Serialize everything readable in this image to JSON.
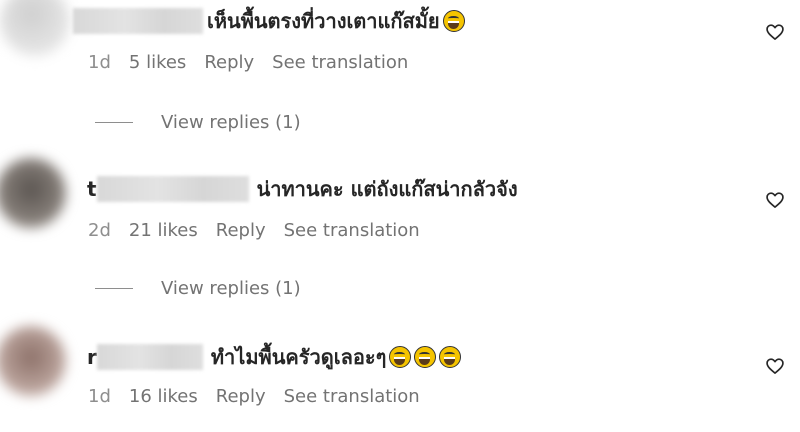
{
  "comments": [
    {
      "username_initial": "",
      "text": "เห็นพื้นตรงที่วางเตาแก๊สมั้ย",
      "emoji_count": 1,
      "time": "1d",
      "likes": "5 likes",
      "reply": "Reply",
      "translation": "See translation",
      "view_replies": "View replies (1)",
      "like_icon": "heart-outline-icon"
    },
    {
      "username_initial": "t",
      "text": "น่าทานคะ แต่ถังแก๊สน่ากลัวจัง",
      "emoji_count": 0,
      "time": "2d",
      "likes": "21 likes",
      "reply": "Reply",
      "translation": "See translation",
      "view_replies": "View replies (1)",
      "like_icon": "heart-outline-icon"
    },
    {
      "username_initial": "r",
      "text": "ทำไมพื้นครัวดูเลอะๆ",
      "emoji_count": 3,
      "time": "1d",
      "likes": "16 likes",
      "reply": "Reply",
      "translation": "See translation",
      "like_icon": "heart-outline-icon"
    }
  ],
  "colors": {
    "text_primary": "#262626",
    "text_secondary": "#737373",
    "emoji_face": "#f5c400"
  }
}
